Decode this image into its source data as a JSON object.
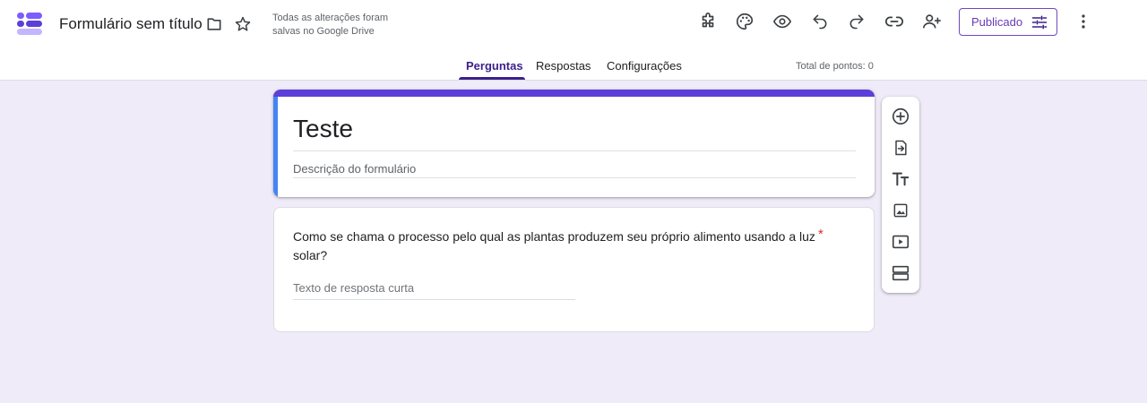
{
  "header": {
    "doc_title": "Formulário sem título",
    "save_status": "Todas as alterações foram salvas no Google Drive",
    "publish_label": "Publicado",
    "icons": [
      "folder-icon",
      "star-icon",
      "addon-puzzle-icon",
      "palette-icon",
      "preview-eye-icon",
      "undo-icon",
      "redo-icon",
      "link-icon",
      "add-collaborator-icon",
      "tune-icon",
      "more-vert-icon"
    ]
  },
  "tabs": [
    {
      "label": "Perguntas",
      "active": true
    },
    {
      "label": "Respostas",
      "active": false
    },
    {
      "label": "Configurações",
      "active": false
    }
  ],
  "total_points": "Total de pontos: 0",
  "form": {
    "title": "Teste",
    "description_placeholder": "Descrição do formulário"
  },
  "question": {
    "text": "Como se chama o processo pelo qual as plantas produzem seu próprio alimento usando a luz solar?",
    "required_mark": "*",
    "answer_placeholder": "Texto de resposta curta"
  },
  "side_toolbar": {
    "icons": [
      "add-question-icon",
      "import-questions-icon",
      "add-title-icon",
      "add-image-icon",
      "add-video-icon",
      "add-section-icon"
    ]
  },
  "colors": {
    "background": "#f0ebf8",
    "accent": "#673ab7",
    "title_bar": "#5b3fd8",
    "active_card_bar": "#4285f4",
    "required": "#d93025"
  }
}
